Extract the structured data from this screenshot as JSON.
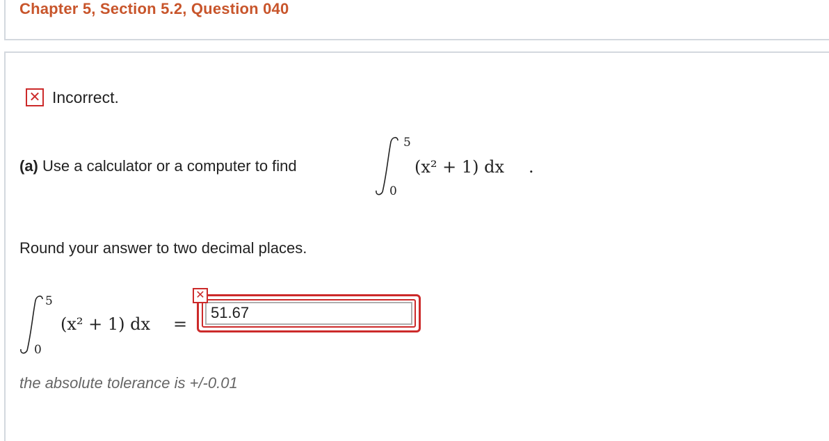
{
  "header": {
    "title": "Chapter 5, Section 5.2, Question 040"
  },
  "status": {
    "icon": "x-mark-icon",
    "text": "Incorrect."
  },
  "part_a": {
    "label": "(a)",
    "prompt": "Use a calculator or a computer to find",
    "integral": {
      "upper": "5",
      "lower": "0",
      "integrand": "(x² + 1) dx",
      "end": "."
    }
  },
  "instructions": "Round your answer to two decimal places.",
  "answer": {
    "integral": {
      "upper": "5",
      "lower": "0",
      "integrand": "(x² + 1) dx",
      "equals": "="
    },
    "value": "51.67",
    "status_icon": "x-mark-icon"
  },
  "tolerance": "the absolute tolerance is +/-0.01",
  "colors": {
    "title": "#c8552b",
    "error": "#cc2a2a",
    "border": "#d3d8de"
  }
}
